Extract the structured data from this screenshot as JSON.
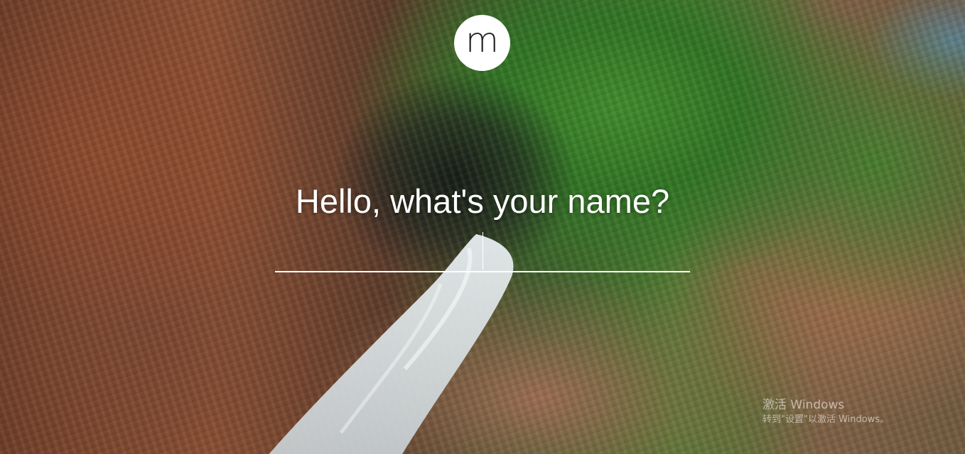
{
  "logo": {
    "glyph": "m",
    "bg_color": "#ffffff"
  },
  "prompt": {
    "question": "Hello, what's your name?",
    "name_value": ""
  },
  "activation_watermark": {
    "title": "激活 Windows",
    "subtitle": "转到\"设置\"以激活 Windows。"
  },
  "background": {
    "description_icon": "landscape-photo"
  }
}
